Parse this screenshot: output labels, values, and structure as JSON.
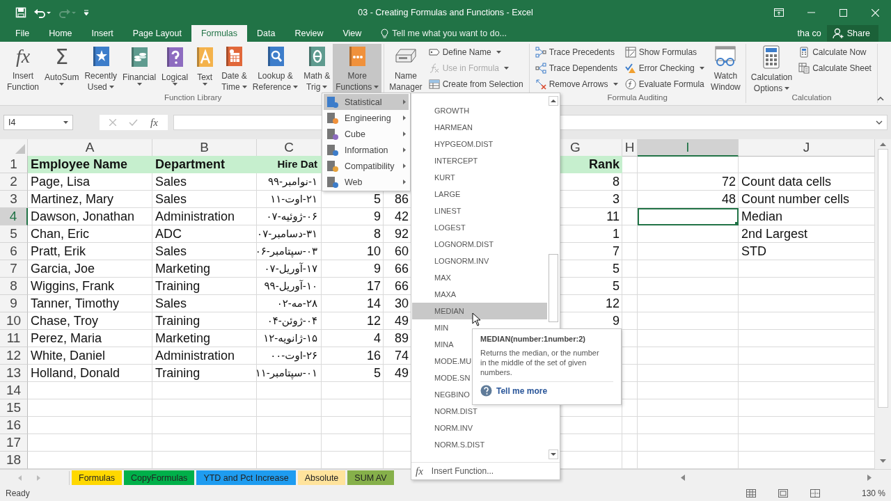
{
  "window": {
    "title": "03 - Creating Formulas and Functions - Excel"
  },
  "ribbon_tabs": [
    {
      "label": "File",
      "selected": false
    },
    {
      "label": "Home",
      "selected": false
    },
    {
      "label": "Insert",
      "selected": false
    },
    {
      "label": "Page Layout",
      "selected": false
    },
    {
      "label": "Formulas",
      "selected": true
    },
    {
      "label": "Data",
      "selected": false
    },
    {
      "label": "Review",
      "selected": false
    },
    {
      "label": "View",
      "selected": false
    }
  ],
  "tell_me": {
    "placeholder": "Tell me what you want to do..."
  },
  "account": {
    "user": "tha co",
    "share": "Share"
  },
  "ribbon_groups": [
    {
      "label": "Function Library",
      "items": [
        {
          "kind": "large",
          "lines": [
            "Insert",
            "Function"
          ],
          "glyph": "fx",
          "dropdown": false,
          "pressed": false
        },
        {
          "kind": "large",
          "lines": [
            "AutoSum"
          ],
          "glyph": "Σ",
          "dropdown": true,
          "pressed": false
        },
        {
          "kind": "large",
          "lines": [
            "Recently",
            "Used"
          ],
          "dropdown": true,
          "pressed": false
        },
        {
          "kind": "large",
          "lines": [
            "Financial"
          ],
          "dropdown": true,
          "pressed": false
        },
        {
          "kind": "large",
          "lines": [
            "Logical"
          ],
          "dropdown": true,
          "pressed": false
        },
        {
          "kind": "large",
          "lines": [
            "Text"
          ],
          "dropdown": true,
          "pressed": false
        },
        {
          "kind": "large",
          "lines": [
            "Date &",
            "Time"
          ],
          "dropdown": true,
          "pressed": false
        },
        {
          "kind": "large",
          "lines": [
            "Lookup &",
            "Reference"
          ],
          "dropdown": true,
          "pressed": false
        },
        {
          "kind": "large",
          "lines": [
            "Math &",
            "Trig"
          ],
          "dropdown": true,
          "pressed": false
        },
        {
          "kind": "large",
          "lines": [
            "More",
            "Functions"
          ],
          "dropdown": true,
          "pressed": true
        }
      ]
    },
    {
      "items": [
        {
          "kind": "large",
          "lines": [
            "Name",
            "Manager"
          ],
          "dropdown": false,
          "pressed": false
        },
        {
          "kind": "stack",
          "buttons": [
            {
              "label": "Define Name",
              "dropdown": true,
              "disabled": false
            },
            {
              "label": "Use in Formula",
              "dropdown": true,
              "disabled": true
            },
            {
              "label": "Create from Selection",
              "dropdown": false,
              "disabled": false
            }
          ]
        }
      ]
    },
    {
      "label": "Formula Auditing",
      "items": [
        {
          "kind": "stack",
          "buttons": [
            {
              "label": "Trace Precedents",
              "dropdown": false,
              "disabled": false
            },
            {
              "label": "Trace Dependents",
              "dropdown": false,
              "disabled": false
            },
            {
              "label": "Remove Arrows",
              "dropdown": true,
              "disabled": false
            }
          ]
        },
        {
          "kind": "stack",
          "buttons": [
            {
              "label": "Show Formulas",
              "dropdown": false,
              "disabled": false
            },
            {
              "label": "Error Checking",
              "dropdown": true,
              "disabled": false
            },
            {
              "label": "Evaluate Formula",
              "dropdown": false,
              "disabled": false
            }
          ]
        },
        {
          "kind": "large",
          "lines": [
            "Watch",
            "Window"
          ],
          "dropdown": false,
          "pressed": false
        }
      ]
    },
    {
      "label": "Calculation",
      "items": [
        {
          "kind": "large",
          "lines": [
            "Calculation",
            "Options"
          ],
          "dropdown": true,
          "pressed": false
        },
        {
          "kind": "stack",
          "buttons": [
            {
              "label": "Calculate Now",
              "dropdown": false,
              "disabled": false
            },
            {
              "label": "Calculate Sheet",
              "dropdown": false,
              "disabled": false
            }
          ]
        }
      ]
    }
  ],
  "formula_bar": {
    "name_box": "I4",
    "fx": "fx"
  },
  "sheet": {
    "columns": {
      "A": {
        "label": "A",
        "selected": false
      },
      "B": {
        "label": "B",
        "selected": false
      },
      "C": {
        "label": "C",
        "selected": false
      },
      "G": {
        "label": "G",
        "selected": false
      },
      "H": {
        "label": "H",
        "selected": false
      },
      "I": {
        "label": "I",
        "selected": true
      },
      "J": {
        "label": "J",
        "selected": false
      }
    },
    "rows": [
      {
        "number": "1",
        "kind": "header",
        "selected": false,
        "cells": {
          "A": "Employee Name",
          "B": "Department",
          "C": "Hire Dat",
          "G": "Rank"
        }
      },
      {
        "number": "2",
        "kind": "data",
        "selected": false,
        "cells": {
          "A": "Page, Lisa",
          "B": "Sales",
          "C": "۱-نوامبر-۹۹",
          "G": "8",
          "I": "72",
          "J": "Count data cells"
        }
      },
      {
        "number": "3",
        "kind": "data",
        "selected": false,
        "cells": {
          "A": "Martinez, Mary",
          "B": "Sales",
          "C": "۲۱-اوت-۱۱",
          "D": "5",
          "E": "86",
          "G": "3",
          "I": "48",
          "J": "Count number cells"
        }
      },
      {
        "number": "4",
        "kind": "data",
        "selected": true,
        "cells": {
          "A": "Dawson, Jonathan",
          "B": "Administration",
          "C": "۰۶-ژوئیه-۰۷",
          "D": "9",
          "E": "42",
          "G": "11",
          "J": "Median"
        }
      },
      {
        "number": "5",
        "kind": "data",
        "selected": false,
        "cells": {
          "A": "Chan, Eric",
          "B": "ADC",
          "C": "۳۱-دسامبر-۰۷",
          "D": "8",
          "E": "92",
          "G": "1",
          "J": "2nd Largest"
        }
      },
      {
        "number": "6",
        "kind": "data",
        "selected": false,
        "cells": {
          "A": "Pratt, Erik",
          "B": "Sales",
          "C": "۰۳-سپتامبر-۰۶",
          "D": "10",
          "E": "60",
          "G": "7",
          "J": "STD"
        }
      },
      {
        "number": "7",
        "kind": "data",
        "selected": false,
        "cells": {
          "A": "Garcia, Joe",
          "B": "Marketing",
          "C": "۱۷-آوریل-۰۷",
          "D": "9",
          "E": "66",
          "G": "5"
        }
      },
      {
        "number": "8",
        "kind": "data",
        "selected": false,
        "cells": {
          "A": "Wiggins, Frank",
          "B": "Training",
          "C": "۱۰-آوریل-۹۹",
          "D": "17",
          "E": "66",
          "G": "5"
        }
      },
      {
        "number": "9",
        "kind": "data",
        "selected": false,
        "cells": {
          "A": "Tanner, Timothy",
          "B": "Sales",
          "C": "۲۸-مه-۰۲",
          "D": "14",
          "E": "30",
          "G": "12"
        }
      },
      {
        "number": "10",
        "kind": "data",
        "selected": false,
        "cells": {
          "A": "Chase, Troy",
          "B": "Training",
          "C": "۰۴-ژوئن-۰۴",
          "D": "12",
          "E": "49",
          "G": "9"
        }
      },
      {
        "number": "11",
        "kind": "data",
        "selected": false,
        "cells": {
          "A": "Perez, Maria",
          "B": "Marketing",
          "C": "۱۵-ژانویه-۱۲",
          "D": "4",
          "E": "89"
        }
      },
      {
        "number": "12",
        "kind": "data",
        "selected": false,
        "cells": {
          "A": "White, Daniel",
          "B": "Administration",
          "C": "۲۶-اوت-۰۰",
          "D": "16",
          "E": "74"
        }
      },
      {
        "number": "13",
        "kind": "data",
        "selected": false,
        "cells": {
          "A": "Holland, Donald",
          "B": "Training",
          "C": "۰۱-سپتامبر-۱۱",
          "D": "5",
          "E": "49"
        }
      },
      {
        "number": "14",
        "kind": "data",
        "selected": false
      },
      {
        "number": "15",
        "kind": "data",
        "selected": false
      },
      {
        "number": "16",
        "kind": "data",
        "selected": false
      },
      {
        "number": "17",
        "kind": "data",
        "selected": false
      },
      {
        "number": "18",
        "kind": "data",
        "selected": false
      }
    ]
  },
  "sheet_tabs": [
    {
      "label": "Formulas",
      "color": "#ffd800"
    },
    {
      "label": "CopyFormulas",
      "color": "#00b04a"
    },
    {
      "label": "YTD and Pct Increase",
      "color": "#1e9cf0"
    },
    {
      "label": "Absolute",
      "color": "#ffe39c"
    },
    {
      "label": "SUM AV",
      "color": "#86b04a"
    }
  ],
  "function_menu": {
    "items": [
      {
        "label": "Statistical",
        "selected": true
      },
      {
        "label": "Engineering",
        "selected": false
      },
      {
        "label": "Cube",
        "selected": false
      },
      {
        "label": "Information",
        "selected": false
      },
      {
        "label": "Compatibility",
        "selected": false
      },
      {
        "label": "Web",
        "selected": false
      }
    ]
  },
  "statistical_menu": {
    "items": [
      {
        "label": "GROWTH",
        "selected": false
      },
      {
        "label": "HARMEAN",
        "selected": false
      },
      {
        "label": "HYPGEOM.DIST",
        "selected": false
      },
      {
        "label": "INTERCEPT",
        "selected": false
      },
      {
        "label": "KURT",
        "selected": false
      },
      {
        "label": "LARGE",
        "selected": false
      },
      {
        "label": "LINEST",
        "selected": false
      },
      {
        "label": "LOGEST",
        "selected": false
      },
      {
        "label": "LOGNORM.DIST",
        "selected": false
      },
      {
        "label": "LOGNORM.INV",
        "selected": false
      },
      {
        "label": "MAX",
        "selected": false
      },
      {
        "label": "MAXA",
        "selected": false
      },
      {
        "label": "MEDIAN",
        "selected": true
      },
      {
        "label": "MIN",
        "selected": false
      },
      {
        "label": "MINA",
        "selected": false
      },
      {
        "label": "MODE.MU",
        "selected": false
      },
      {
        "label": "MODE.SN",
        "selected": false
      },
      {
        "label": "NEGBINO",
        "selected": false
      },
      {
        "label": "NORM.DIST",
        "selected": false
      },
      {
        "label": "NORM.INV",
        "selected": false
      },
      {
        "label": "NORM.S.DIST",
        "selected": false
      }
    ],
    "footer": {
      "glyph": "fx",
      "label": "Insert Function..."
    }
  },
  "tooltip": {
    "title": "MEDIAN(number:1number:2)",
    "text": "Returns the median, or the number in the middle of the set of given numbers.",
    "link": "Tell me more"
  },
  "status_bar": {
    "text": "Ready",
    "zoom": "130 %"
  }
}
